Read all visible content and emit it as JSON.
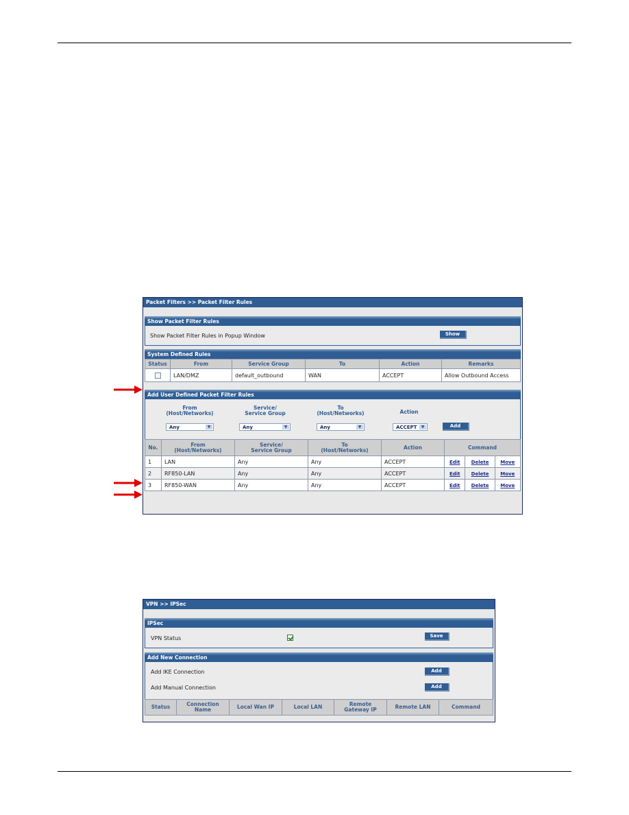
{
  "panel1": {
    "title": "Packet Filters >> Packet Filter Rules",
    "show_section": {
      "heading": "Show Packet Filter Rules",
      "label": "Show Packet Filter Rules in Popup Window",
      "button": "Show"
    },
    "system_rules": {
      "heading": "System Defined Rules",
      "columns": [
        "Status",
        "From",
        "Service Group",
        "To",
        "Action",
        "Remarks"
      ],
      "rows": [
        {
          "status_checked": false,
          "from": "LAN/DMZ",
          "service_group": "default_outbound",
          "to": "WAN",
          "action": "ACCEPT",
          "remarks": "Allow Outbound Access"
        }
      ]
    },
    "add_user": {
      "heading": "Add User Defined Packet Filter Rules",
      "from_label_1": "From",
      "from_label_2": "(Host/Networks)",
      "service_label_1": "Service/",
      "service_label_2": "Service Group",
      "to_label_1": "To",
      "to_label_2": "(Host/Networks)",
      "action_label": "Action",
      "from_value": "Any",
      "service_value": "Any",
      "to_value": "Any",
      "action_value": "ACCEPT",
      "add_button": "Add"
    },
    "user_rules": {
      "columns": {
        "no": "No.",
        "from_1": "From",
        "from_2": "(Host/Networks)",
        "service_1": "Service/",
        "service_2": "Service Group",
        "to_1": "To",
        "to_2": "(Host/Networks)",
        "action": "Action",
        "command": "Command"
      },
      "commands": {
        "edit": "Edit",
        "delete": "Delete",
        "move": "Move"
      },
      "rows": [
        {
          "no": "1",
          "from": "LAN",
          "service": "Any",
          "to": "Any",
          "action": "ACCEPT"
        },
        {
          "no": "2",
          "from": "RF850-LAN",
          "service": "Any",
          "to": "Any",
          "action": "ACCEPT"
        },
        {
          "no": "3",
          "from": "RF850-WAN",
          "service": "Any",
          "to": "Any",
          "action": "ACCEPT"
        }
      ]
    }
  },
  "panel2": {
    "title": "VPN >> IPSec",
    "ipsec": {
      "heading": "IPSec",
      "vpn_status_label": "VPN Status",
      "vpn_status_checked": true,
      "save_button": "Save"
    },
    "add_connection": {
      "heading": "Add New Connection",
      "ike_label": "Add IKE Connection",
      "manual_label": "Add Manual Connection",
      "add_button": "Add",
      "columns": {
        "status": "Status",
        "conn_1": "Connection",
        "conn_2": "Name",
        "local_wan": "Local Wan IP",
        "local_lan": "Local LAN",
        "remote_gw_1": "Remote",
        "remote_gw_2": "Gateway IP",
        "remote_lan": "Remote LAN",
        "command": "Command"
      }
    }
  },
  "annotations": {
    "arrow_color": "#e00000"
  }
}
